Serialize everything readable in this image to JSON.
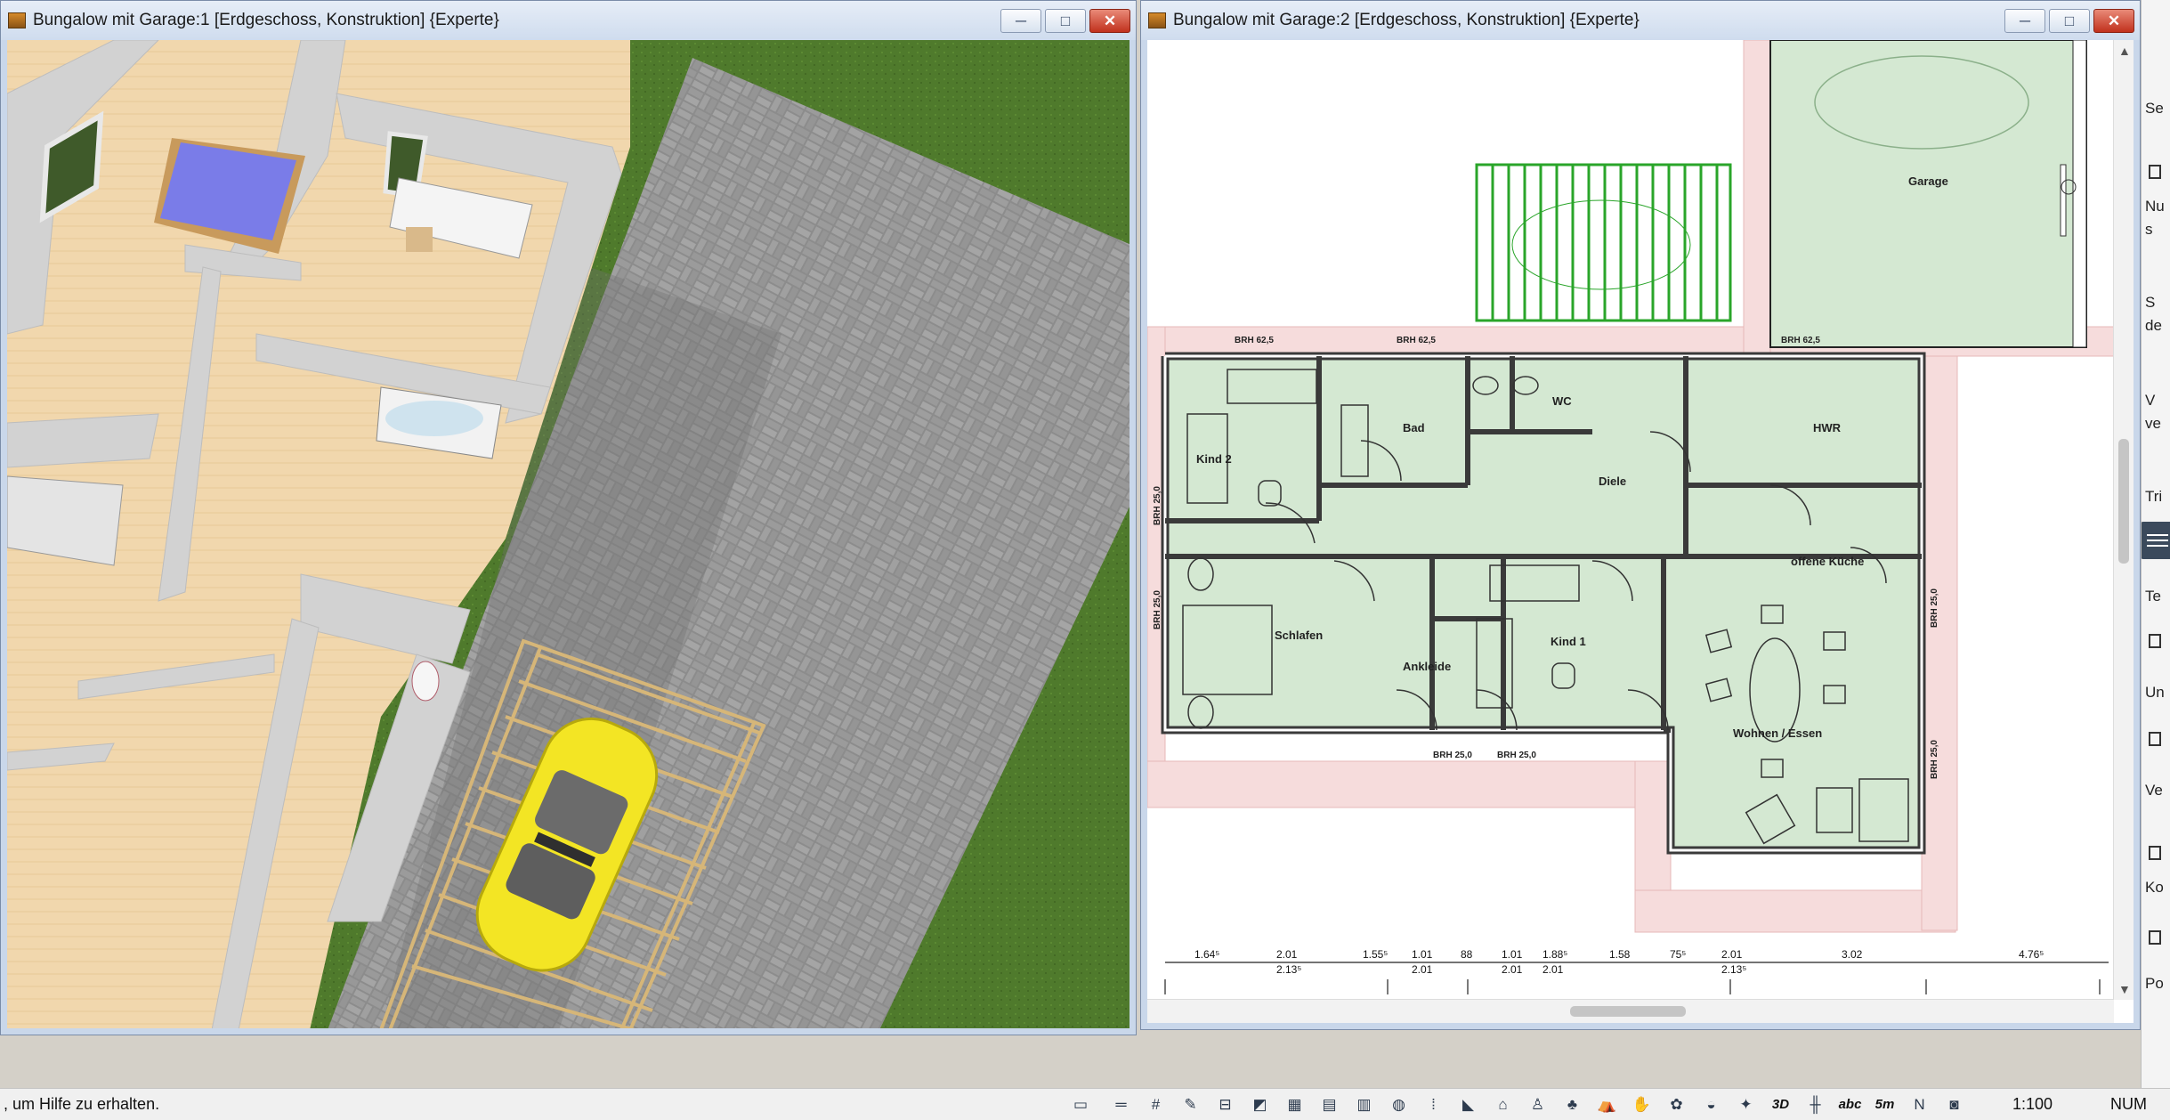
{
  "window1": {
    "title": "Bungalow mit Garage:1 [Erdgeschoss, Konstruktion] {Experte}",
    "buttons": {
      "minimize": "─",
      "maximize": "□",
      "close": "✕"
    }
  },
  "window2": {
    "title": "Bungalow mit Garage:2 [Erdgeschoss, Konstruktion] {Experte}",
    "buttons": {
      "minimize": "─",
      "maximize": "□",
      "close": "✕"
    },
    "scroll": {
      "up": "▲",
      "down": "▼"
    },
    "rooms": {
      "garage": "Garage",
      "kind2": "Kind 2",
      "bad": "Bad",
      "wc": "WC",
      "hwr": "HWR",
      "diele": "Diele",
      "offene_kueche": "offene Küche",
      "schlafen": "Schlafen",
      "ankleide": "Ankleide",
      "kind1": "Kind 1",
      "wohnen_essen": "Wohnen / Essen"
    },
    "brh": {
      "top1": "BRH 62,5",
      "top2": "BRH 62,5",
      "top3": "BRH 62,5",
      "left1": "BRH 25,0",
      "left2": "BRH 25,0",
      "right1": "BRH 25,0",
      "right2": "BRH 25,0",
      "bottom1": "BRH 25,0",
      "bottom2": "BRH 25,0"
    },
    "dimensions": [
      {
        "top": "1.64⁵",
        "bottom": ""
      },
      {
        "top": "2.01",
        "bottom": "2.13⁵"
      },
      {
        "top": "1.55⁵",
        "bottom": ""
      },
      {
        "top": "1.01",
        "bottom": "2.01"
      },
      {
        "top": "88",
        "bottom": ""
      },
      {
        "top": "1.01",
        "bottom": "2.01"
      },
      {
        "top": "1.88⁵",
        "bottom": "2.01"
      },
      {
        "top": "1.58",
        "bottom": ""
      },
      {
        "top": "75⁵",
        "bottom": ""
      },
      {
        "top": "2.01",
        "bottom": "2.13⁵"
      },
      {
        "top": "3.02",
        "bottom": ""
      },
      {
        "top": "4.76⁵",
        "bottom": ""
      }
    ]
  },
  "side_panel": {
    "items": [
      "Se",
      "Nu",
      "s",
      "S",
      "de",
      "V",
      "ve",
      "Tri",
      "Te",
      "Un",
      "Ve",
      "Ko",
      "Po"
    ]
  },
  "statusbar": {
    "help_text": ", um Hilfe zu erhalten.",
    "scale": "1:100",
    "num": "NUM",
    "tools": [
      {
        "name": "layer-icon",
        "glyph": "▭"
      },
      {
        "name": "line-style-icon",
        "glyph": "═"
      },
      {
        "name": "grid-icon",
        "glyph": "#"
      },
      {
        "name": "pencil-icon",
        "glyph": "✎"
      },
      {
        "name": "dimension-icon",
        "glyph": "⊟"
      },
      {
        "name": "terrain-icon",
        "glyph": "◩"
      },
      {
        "name": "texture-icon",
        "glyph": "▦"
      },
      {
        "name": "hatching-icon",
        "glyph": "▤"
      },
      {
        "name": "fill-icon",
        "glyph": "▥"
      },
      {
        "name": "paint-icon",
        "glyph": "◍"
      },
      {
        "name": "steps-icon",
        "glyph": "⁞"
      },
      {
        "name": "stair-icon",
        "glyph": "◣"
      },
      {
        "name": "furniture-icon",
        "glyph": "⌂"
      },
      {
        "name": "chair-icon",
        "glyph": "♙"
      },
      {
        "name": "tree-icon",
        "glyph": "♣"
      },
      {
        "name": "roof-icon",
        "glyph": "⛺"
      },
      {
        "name": "hand-icon",
        "glyph": "✋"
      },
      {
        "name": "plant-icon",
        "glyph": "✿"
      },
      {
        "name": "bath-icon",
        "glyph": "◒"
      },
      {
        "name": "garden-icon",
        "glyph": "✦"
      },
      {
        "name": "3d-icon",
        "glyph": "3D"
      },
      {
        "name": "section-icon",
        "glyph": "╫"
      },
      {
        "name": "text-icon",
        "glyph": "abc"
      },
      {
        "name": "measure-icon",
        "glyph": "5m"
      },
      {
        "name": "north-icon",
        "glyph": "N"
      },
      {
        "name": "camera-icon",
        "glyph": "◙"
      }
    ]
  },
  "colors": {
    "grass": "#4f7a2c",
    "paving": "#8a8a8a",
    "room_fill": "#d4e8d2",
    "terrace": "#f4d9d9",
    "wall": "#3a3a3a",
    "car": "#f3e524"
  }
}
